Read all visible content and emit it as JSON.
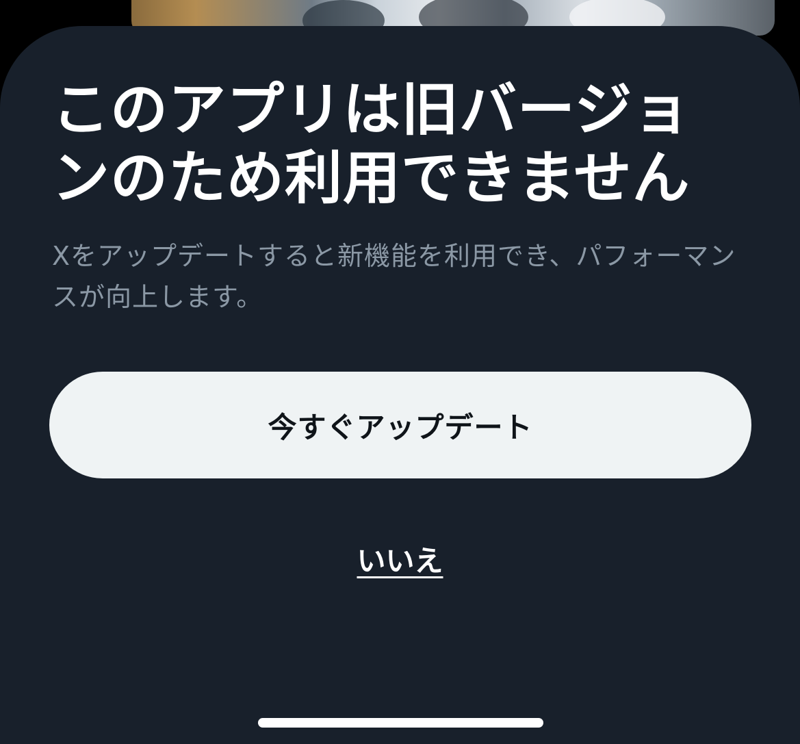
{
  "dialog": {
    "title": "このアプリは旧バージョンのため利用できません",
    "message": "Xをアップデートすると新機能を利用でき、パフォーマンスが向上します。",
    "update_button_label": "今すぐアップデート",
    "decline_label": "いいえ"
  },
  "colors": {
    "sheet_background": "#18202b",
    "title_text": "#ffffff",
    "message_text": "#8b98a5",
    "button_background": "#eff3f4",
    "button_text": "#0f1419"
  }
}
